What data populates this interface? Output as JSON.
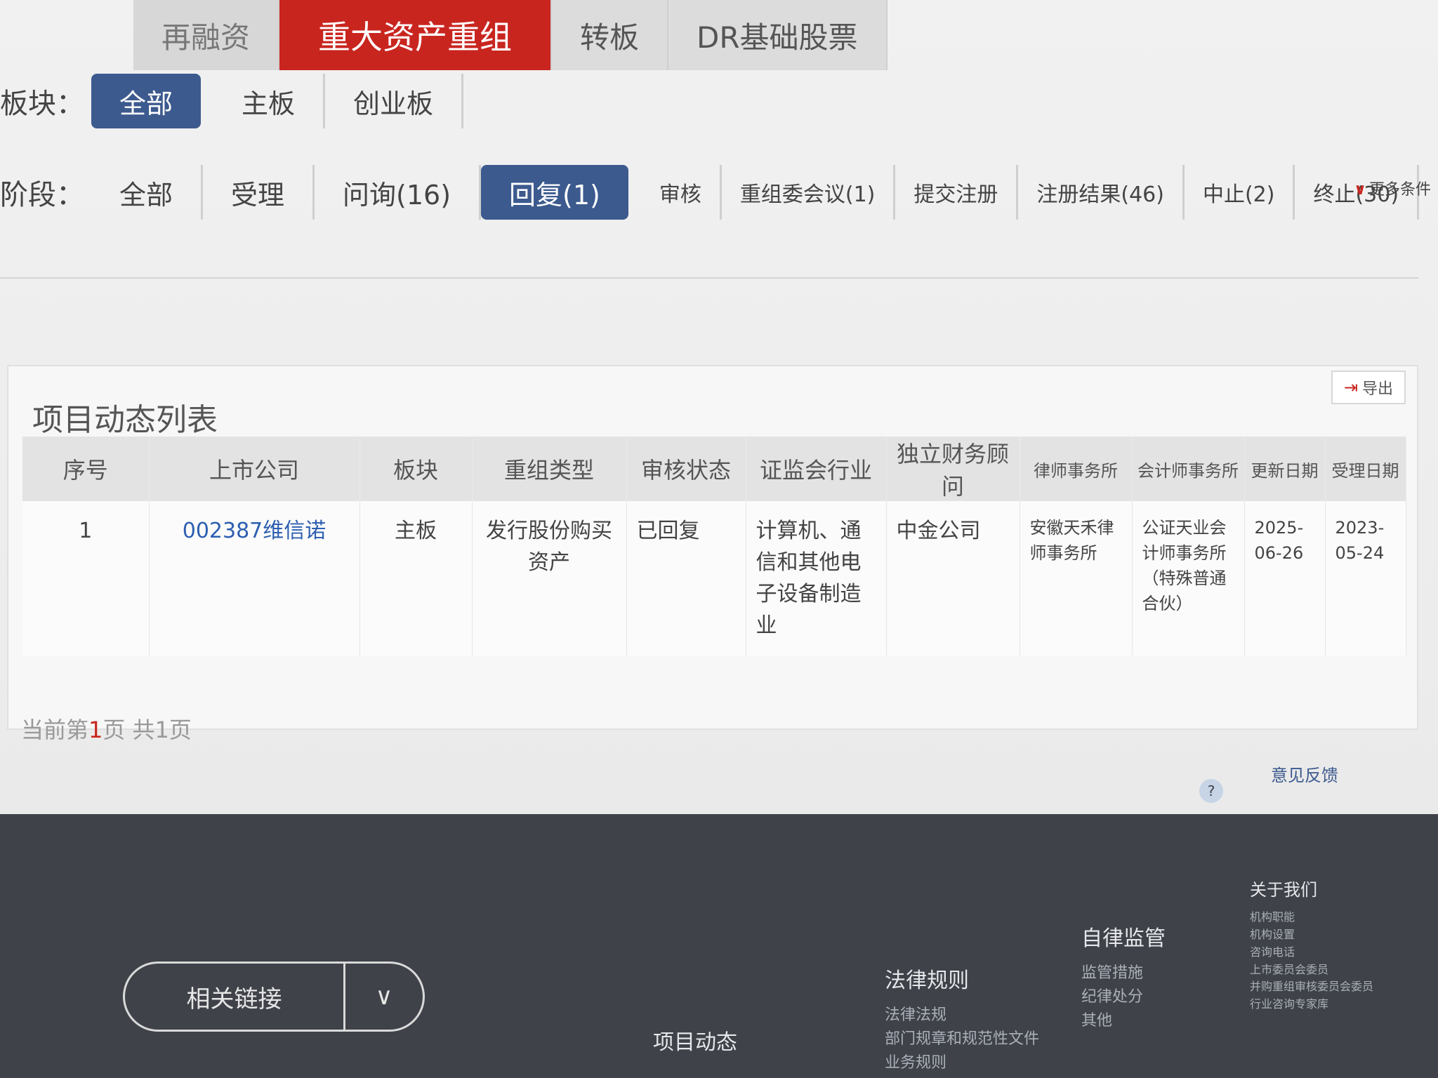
{
  "top_tabs": [
    "再融资",
    "重大资产重组",
    "转板",
    "DR基础股票"
  ],
  "board_filter": {
    "label": "板块：",
    "options": [
      "全部",
      "主板",
      "创业板"
    ]
  },
  "stage_filter": {
    "label": "阶段：",
    "options": [
      "全部",
      "受理",
      "问询(16)",
      "回复(1)",
      "审核",
      "重组委会议(1)",
      "提交注册",
      "注册结果(46)",
      "中止(2)",
      "终止(30)"
    ]
  },
  "more_conditions": "更多条件",
  "panel": {
    "title": "项目动态列表",
    "export_label": "导出"
  },
  "table": {
    "headers": [
      "序号",
      "上市公司",
      "板块",
      "重组类型",
      "审核状态",
      "证监会行业",
      "独立财务顾问",
      "律师事务所",
      "会计师事务所",
      "更新日期",
      "受理日期"
    ],
    "rows": [
      {
        "index": "1",
        "company": "002387维信诺",
        "board": "主板",
        "type": "发行股份购买资产",
        "status": "已回复",
        "industry": "计算机、通信和其他电子设备制造业",
        "advisor": "中金公司",
        "law_firm": "安徽天禾律师事务所",
        "accounting_firm": "公证天业会计师事务所（特殊普通合伙）",
        "updated": "2025-06-26",
        "accepted": "2023-05-24"
      }
    ]
  },
  "pager": {
    "prefix": "当前第",
    "current": "1",
    "suffix": "页 共1页"
  },
  "footer": {
    "links_button": "相关链接",
    "project_dynamics": "项目动态",
    "law_col": {
      "heading": "法律规则",
      "items": [
        "法律法规",
        "部门规章和规范性文件",
        "业务规则"
      ]
    },
    "self_reg_col": {
      "heading": "自律监管",
      "items": [
        "监管措施",
        "纪律处分",
        "其他"
      ]
    },
    "about_col": {
      "heading": "关于我们",
      "items": [
        "机构职能",
        "机构设置",
        "咨询电话",
        "上市委员会委员",
        "并购重组审核委员会委员",
        "行业咨询专家库"
      ]
    },
    "top_link": "意见反馈"
  }
}
